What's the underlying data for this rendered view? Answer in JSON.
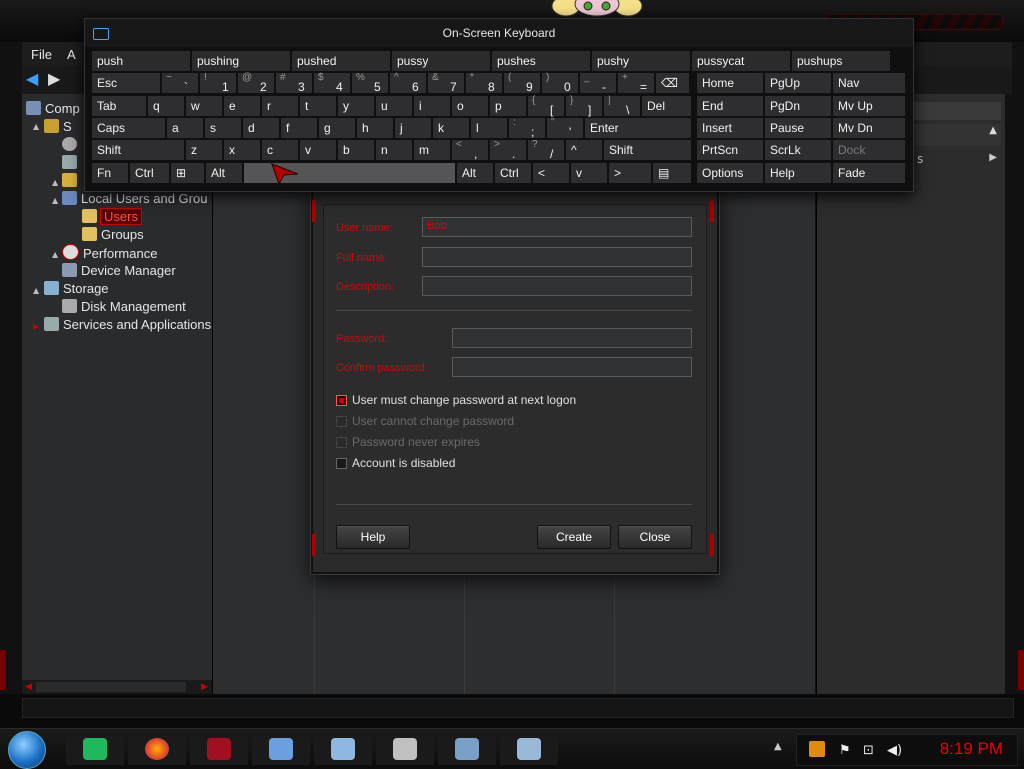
{
  "main_window": {
    "menu": [
      "File",
      "A"
    ],
    "tree": [
      {
        "label": "Comp",
        "level": 0
      },
      {
        "label": "S",
        "level": 1
      },
      {
        "label": "Local Users and Grou",
        "level": 1
      },
      {
        "label": "Users",
        "level": 2,
        "selected": true
      },
      {
        "label": "Groups",
        "level": 2
      },
      {
        "label": "Performance",
        "level": 1
      },
      {
        "label": "Device Manager",
        "level": 1
      },
      {
        "label": "Storage",
        "level": 0
      },
      {
        "label": "Disk Management",
        "level": 1
      },
      {
        "label": "Services and Applications",
        "level": 0
      }
    ],
    "right_pane_partial_text": "s"
  },
  "osk": {
    "title": "On-Screen Keyboard",
    "suggestions": [
      "push",
      "pushing",
      "pushed",
      "pussy",
      "pushes",
      "pushy",
      "pussycat",
      "pushups"
    ],
    "row1": [
      {
        "label": "Esc"
      },
      {
        "up": "~",
        "lo": "`"
      },
      {
        "up": "!",
        "lo": "1"
      },
      {
        "up": "@",
        "lo": "2"
      },
      {
        "up": "#",
        "lo": "3"
      },
      {
        "up": "$",
        "lo": "4"
      },
      {
        "up": "%",
        "lo": "5"
      },
      {
        "up": "^",
        "lo": "6"
      },
      {
        "up": "&",
        "lo": "7"
      },
      {
        "up": "*",
        "lo": "8"
      },
      {
        "up": "(",
        "lo": "9"
      },
      {
        "up": ")",
        "lo": "0"
      },
      {
        "up": "_",
        "lo": "-"
      },
      {
        "up": "+",
        "lo": "="
      },
      {
        "label": "⌫"
      }
    ],
    "row2": [
      {
        "label": "Tab"
      },
      {
        "label": "q"
      },
      {
        "label": "w"
      },
      {
        "label": "e"
      },
      {
        "label": "r"
      },
      {
        "label": "t"
      },
      {
        "label": "y"
      },
      {
        "label": "u"
      },
      {
        "label": "i"
      },
      {
        "label": "o"
      },
      {
        "label": "p"
      },
      {
        "up": "{",
        "lo": "["
      },
      {
        "up": "}",
        "lo": "]"
      },
      {
        "up": "|",
        "lo": "\\"
      },
      {
        "label": "Del"
      }
    ],
    "row3": [
      {
        "label": "Caps"
      },
      {
        "label": "a"
      },
      {
        "label": "s"
      },
      {
        "label": "d"
      },
      {
        "label": "f"
      },
      {
        "label": "g"
      },
      {
        "label": "h"
      },
      {
        "label": "j"
      },
      {
        "label": "k"
      },
      {
        "label": "l"
      },
      {
        "up": ":",
        "lo": ";"
      },
      {
        "up": "\"",
        "lo": "'"
      },
      {
        "label": "Enter"
      }
    ],
    "row4": [
      {
        "label": "Shift"
      },
      {
        "label": "z"
      },
      {
        "label": "x"
      },
      {
        "label": "c"
      },
      {
        "label": "v"
      },
      {
        "label": "b"
      },
      {
        "label": "n"
      },
      {
        "label": "m"
      },
      {
        "up": "<",
        "lo": ","
      },
      {
        "up": ">",
        "lo": "."
      },
      {
        "up": "?",
        "lo": "/"
      },
      {
        "label": "^"
      },
      {
        "label": "Shift"
      }
    ],
    "row5": [
      {
        "label": "Fn"
      },
      {
        "label": "Ctrl"
      },
      {
        "label": "⊞"
      },
      {
        "label": "Alt"
      },
      {
        "label": ""
      },
      {
        "label": "Alt"
      },
      {
        "label": "Ctrl"
      },
      {
        "label": "<"
      },
      {
        "label": "v"
      },
      {
        "label": ">"
      },
      {
        "label": "▤"
      }
    ],
    "side_keys": [
      [
        "Home",
        "PgUp",
        "Nav"
      ],
      [
        "End",
        "PgDn",
        "Mv Up"
      ],
      [
        "Insert",
        "Pause",
        "Mv Dn"
      ],
      [
        "PrtScn",
        "ScrLk",
        "Dock"
      ],
      [
        "Options",
        "Help",
        "Fade"
      ]
    ]
  },
  "dialog": {
    "labels": {
      "user_name": "User name:",
      "full_name": "Full name:",
      "description": "Description:",
      "password": "Password:",
      "confirm_password": "Confirm password:"
    },
    "values": {
      "user_name": "Bob",
      "full_name": "",
      "description": "",
      "password": "",
      "confirm_password": ""
    },
    "checkboxes": [
      {
        "label": "User must change password at next logon",
        "checked": true,
        "disabled": false
      },
      {
        "label": "User cannot change password",
        "checked": false,
        "disabled": true
      },
      {
        "label": "Password never expires",
        "checked": false,
        "disabled": true
      },
      {
        "label": "Account is disabled",
        "checked": false,
        "disabled": false
      }
    ],
    "buttons": {
      "help": "Help",
      "create": "Create",
      "close": "Close"
    }
  },
  "taskbar": {
    "clock": "8:19 PM",
    "apps": [
      "notes-app-icon",
      "firefox-icon",
      "media-app-icon",
      "remote-desktop-icon",
      "window-app-icon",
      "server-lock-icon",
      "network-computer-icon",
      "keyboard-icon"
    ]
  },
  "colors": {
    "accent_red": "#cc0000",
    "clock_red": "#ee0000",
    "dialog_bg": "#2c2c2d"
  }
}
